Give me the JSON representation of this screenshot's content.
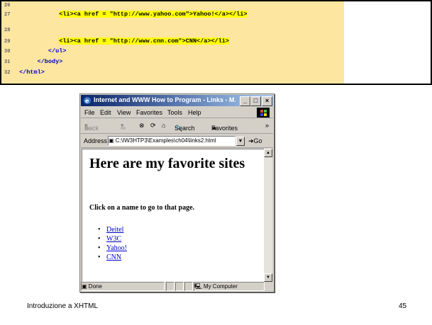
{
  "code": {
    "lines": [
      {
        "num": "26",
        "text": ""
      },
      {
        "num": "27",
        "pre": "            ",
        "html": "<li><a href = \"http://www.yahoo.com\">Yahoo!</a></li>"
      },
      {
        "num": "28",
        "text": ""
      },
      {
        "num": "29",
        "pre": "            ",
        "html": "<li><a href = \"http://www.cnn.com\">CNN</a></li>"
      },
      {
        "num": "30",
        "pre": "         ",
        "html": "</ul>"
      },
      {
        "num": "31",
        "pre": "      ",
        "html": "</body>"
      },
      {
        "num": "32",
        "pre": " ",
        "html": "</html>"
      }
    ]
  },
  "browser": {
    "title": "Internet and WWW How to Program - Links - M...",
    "menu": [
      "File",
      "Edit",
      "View",
      "Favorites",
      "Tools",
      "Help"
    ],
    "toolbar": {
      "back": "Back",
      "search": "Search",
      "favorites": "Favorites"
    },
    "address_label": "Address",
    "address_value": "C:\\IW3HTP3\\Examples\\ch04\\links2.html",
    "go_label": "Go",
    "heading": "Here are my favorite sites",
    "paragraph": "Click on a name to go to that page.",
    "links": [
      "Deitel",
      "W3C",
      "Yahoo!",
      "CNN"
    ],
    "status_left": "Done",
    "status_zone": "My Computer"
  },
  "footer": {
    "title": "Introduzione a XHTML",
    "page": "45"
  }
}
